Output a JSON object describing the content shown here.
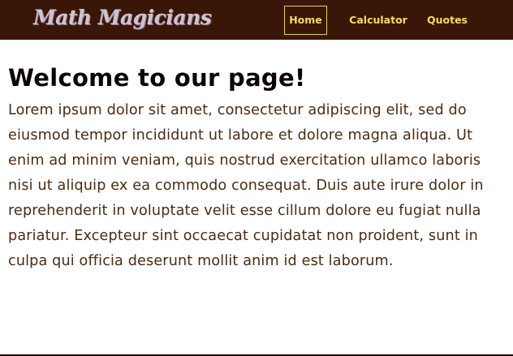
{
  "navbar": {
    "brand": "Math Magicians",
    "links": [
      {
        "label": "Home",
        "active": true
      },
      {
        "label": "Calculator",
        "active": false
      },
      {
        "label": "Quotes",
        "active": false
      }
    ]
  },
  "main": {
    "title": "Welcome to our page!",
    "body": "Lorem ipsum dolor sit amet, consectetur adipiscing elit, sed do eiusmod tempor incididunt ut labore et dolore magna aliqua. Ut enim ad minim veniam, quis nostrud exercitation ullamco laboris nisi ut aliquip ex ea commodo consequat. Duis aute irure dolor in reprehenderit in voluptate velit esse cillum dolore eu fugiat nulla pariatur. Excepteur sint occaecat cupidatat non proident, sunt in culpa qui officia deserunt mollit anim id est laborum."
  },
  "colors": {
    "navbar_bg": "#3a1609",
    "nav_link": "#f4dc5e",
    "logo": "#cfc3cf",
    "title": "#0d0503",
    "body_text": "#4a2b14"
  }
}
